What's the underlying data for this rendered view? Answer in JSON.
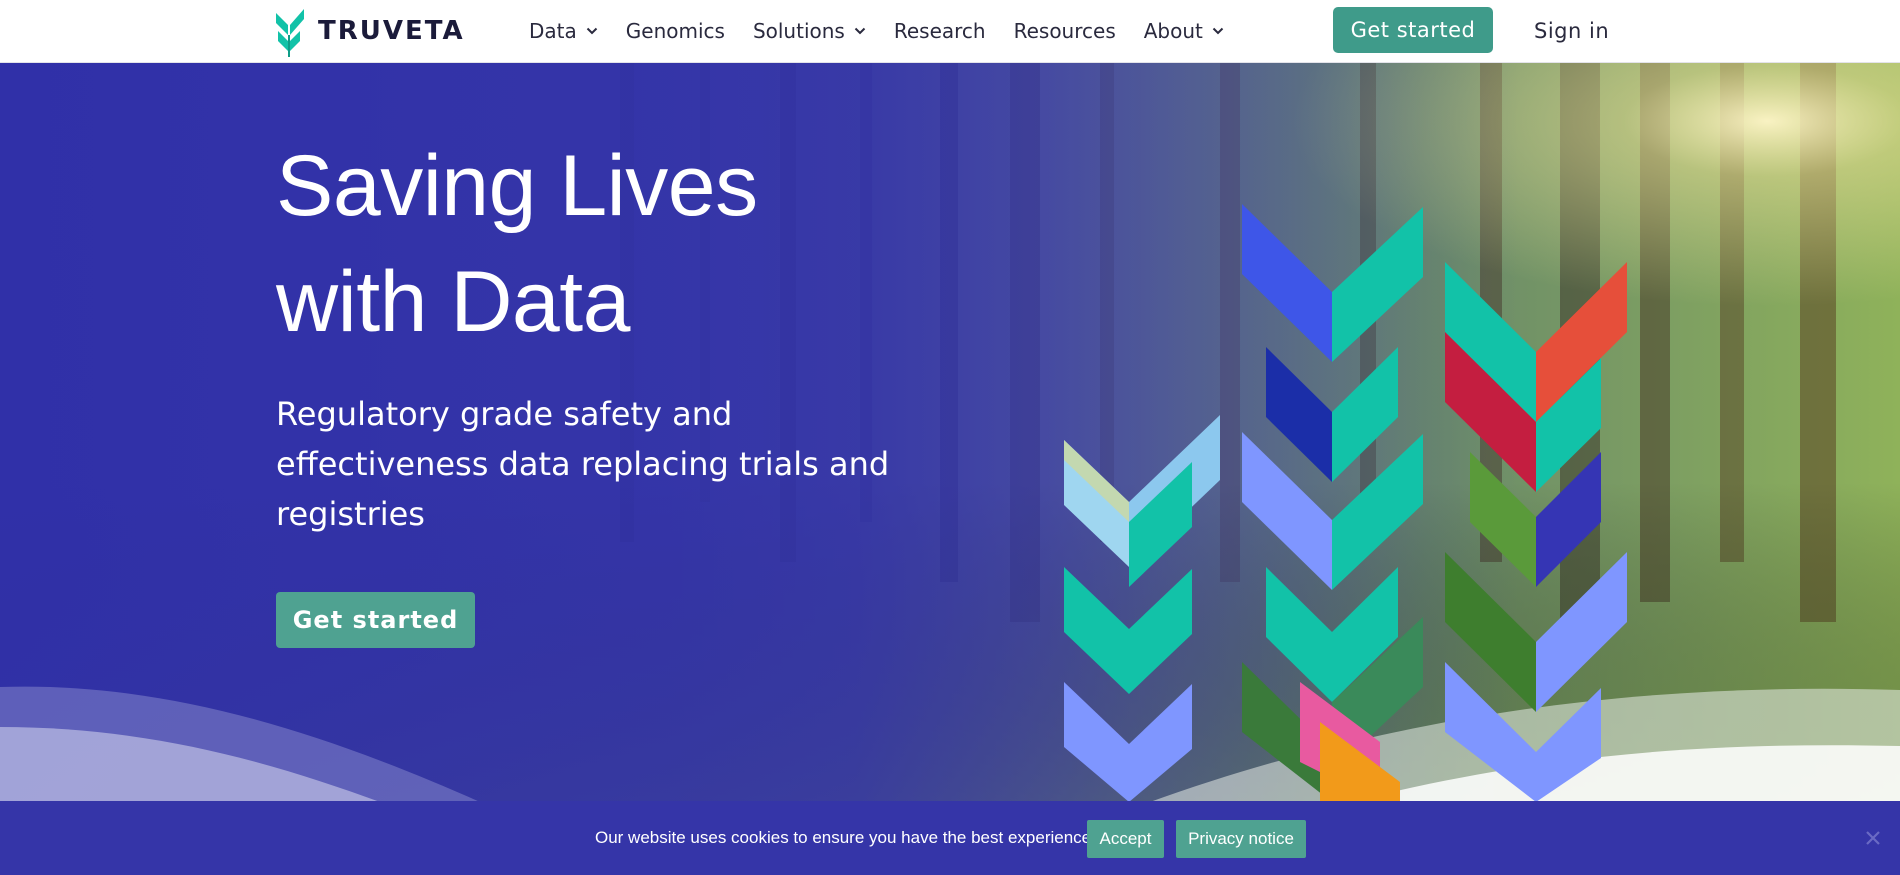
{
  "brand": {
    "name": "TRUVETA",
    "colors": {
      "accent": "#3f9b8a",
      "hero_blue": "#3535a8",
      "teal_leaf": "#12c2a8",
      "periwinkle_leaf": "#7f96ff",
      "navy_text": "#1b1b3a"
    }
  },
  "nav": {
    "items": [
      {
        "label": "Data",
        "has_dropdown": true
      },
      {
        "label": "Genomics",
        "has_dropdown": false
      },
      {
        "label": "Solutions",
        "has_dropdown": true
      },
      {
        "label": "Research",
        "has_dropdown": false
      },
      {
        "label": "Resources",
        "has_dropdown": false
      },
      {
        "label": "About",
        "has_dropdown": true
      }
    ],
    "cta_label": "Get started",
    "signin_label": "Sign in",
    "icons": {
      "dropdown": "chevron-down-icon",
      "logo": "truveta-logo-icon"
    }
  },
  "hero": {
    "title_line1": "Saving Lives",
    "title_line2": "with Data",
    "subtitle": "Regulatory grade safety and effectiveness data replacing trials and registries",
    "cta_label": "Get started"
  },
  "cookie": {
    "message": "Our website uses cookies to ensure you have the best experience.",
    "accept_label": "Accept",
    "privacy_label": "Privacy notice",
    "close_icon": "close-icon"
  }
}
